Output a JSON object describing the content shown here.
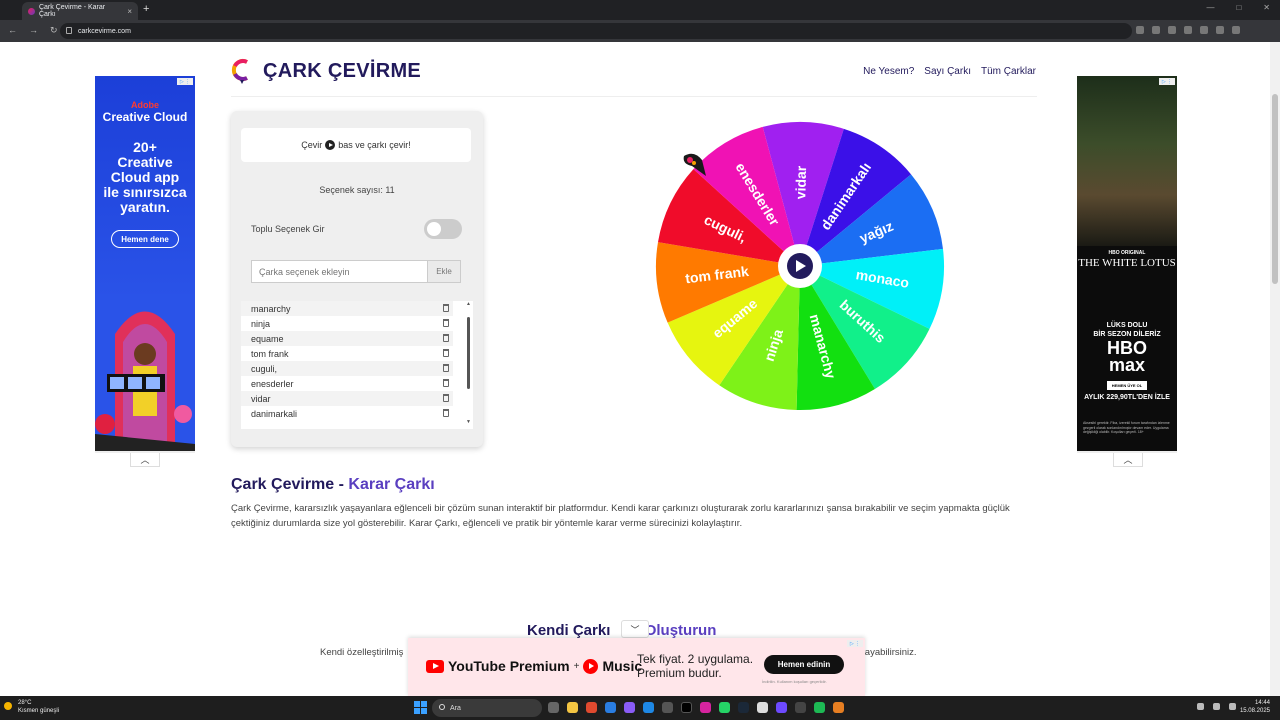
{
  "browser": {
    "tab_title": "Çark Çevirme - Karar Çarkı",
    "tab_close": "×",
    "new_tab": "+",
    "url": "carkcevirme.com"
  },
  "header": {
    "logo_text": "ÇARK ÇEVİRME",
    "nav": [
      "Ne Yesem?",
      "Sayı Çarkı",
      "Tüm Çarklar"
    ]
  },
  "panel": {
    "hint_pre": "Çevir",
    "hint_post": "bas ve çarkı çevir!",
    "count_label": "Seçenek sayısı: 11",
    "bulk_label": "Toplu Seçenek Gir",
    "bulk_enabled": false,
    "add_placeholder": "Çarka seçenek ekleyin",
    "add_button": "Ekle",
    "options": [
      "manarchy",
      "ninja",
      "equame",
      "tom frank",
      "cuguli,",
      "enesderler",
      "vidar",
      "danimarkali"
    ]
  },
  "wheel": {
    "segments": [
      {
        "label": "vidar",
        "color": "#a020f0"
      },
      {
        "label": "danimarkalı",
        "color": "#3b10e8"
      },
      {
        "label": "yağız",
        "color": "#1b6ef3"
      },
      {
        "label": "monaco",
        "color": "#00f0f8"
      },
      {
        "label": "buruthis",
        "color": "#11f08a"
      },
      {
        "label": "manarchy",
        "color": "#12e010"
      },
      {
        "label": "ninja",
        "color": "#7ef218"
      },
      {
        "label": "equame",
        "color": "#e6f50f"
      },
      {
        "label": "tom frank",
        "color": "#ff7a00"
      },
      {
        "label": "cuguli,",
        "color": "#f00c2a"
      },
      {
        "label": "enesderler",
        "color": "#f012b4"
      }
    ]
  },
  "content": {
    "h2_main": "Çark Çevirme -",
    "h2_accent": "Karar Çarkı",
    "para": "Çark Çevirme, kararsızlık yaşayanlara eğlenceli bir çözüm sunan interaktif bir platformdur. Kendi karar çarkınızı oluşturarak zorlu kararlarınızı şansa bırakabilir ve seçim yapmakta güçlük çektiğiniz durumlarda size yol gösterebilir. Karar Çarkı, eğlenceli ve pratik bir yöntemle karar verme sürecinizi kolaylaştırır.",
    "h3_main": "Kendi Çarkı",
    "h3_accent": "Oluşturun",
    "para2_start": "Kendi özelleştirilmiş",
    "para2_end": "yaşayabilirsiniz."
  },
  "ads": {
    "left": {
      "brand": "Adobe",
      "product": "Creative Cloud",
      "headline_lines": [
        "20+",
        "Creative",
        "Cloud app",
        "ile sınırsızca",
        "yaratın."
      ],
      "cta": "Hemen dene"
    },
    "right": {
      "hbo_orig": "HBO ORIGINAL",
      "title": "THE WHITE LOTUS",
      "lux_lines": [
        "LÜKS DOLU",
        "BİR SEZON DİLERİZ"
      ],
      "hbomax_lines": [
        "HBO",
        "max"
      ],
      "uye": "HEMEN ÜYE OL",
      "price": "AYLIK 229,90TL'DEN İZLE",
      "fine": "Aksesibl gerektir. Fiba, izerekil forum tarafından izlenme gezgeril olarak sonlandırılmıştır devam eder. Uygulama değişikliği olabilir. Koşulları geçerli. 18+"
    },
    "bottom": {
      "yt_premium": "YouTube Premium",
      "plus": "+",
      "music": "Music",
      "offer_lines": [
        "Tek fiyat. 2 uygulama.",
        "Premium budur."
      ],
      "cta": "Hemen edinin",
      "fine": "İndirilin. Kullanım koşulları geçerlidir."
    }
  },
  "taskbar": {
    "temp": "28°C",
    "weather": "Kısmen güneşli",
    "search": "Ara",
    "time": "14:44",
    "date": "15.08.2025"
  }
}
